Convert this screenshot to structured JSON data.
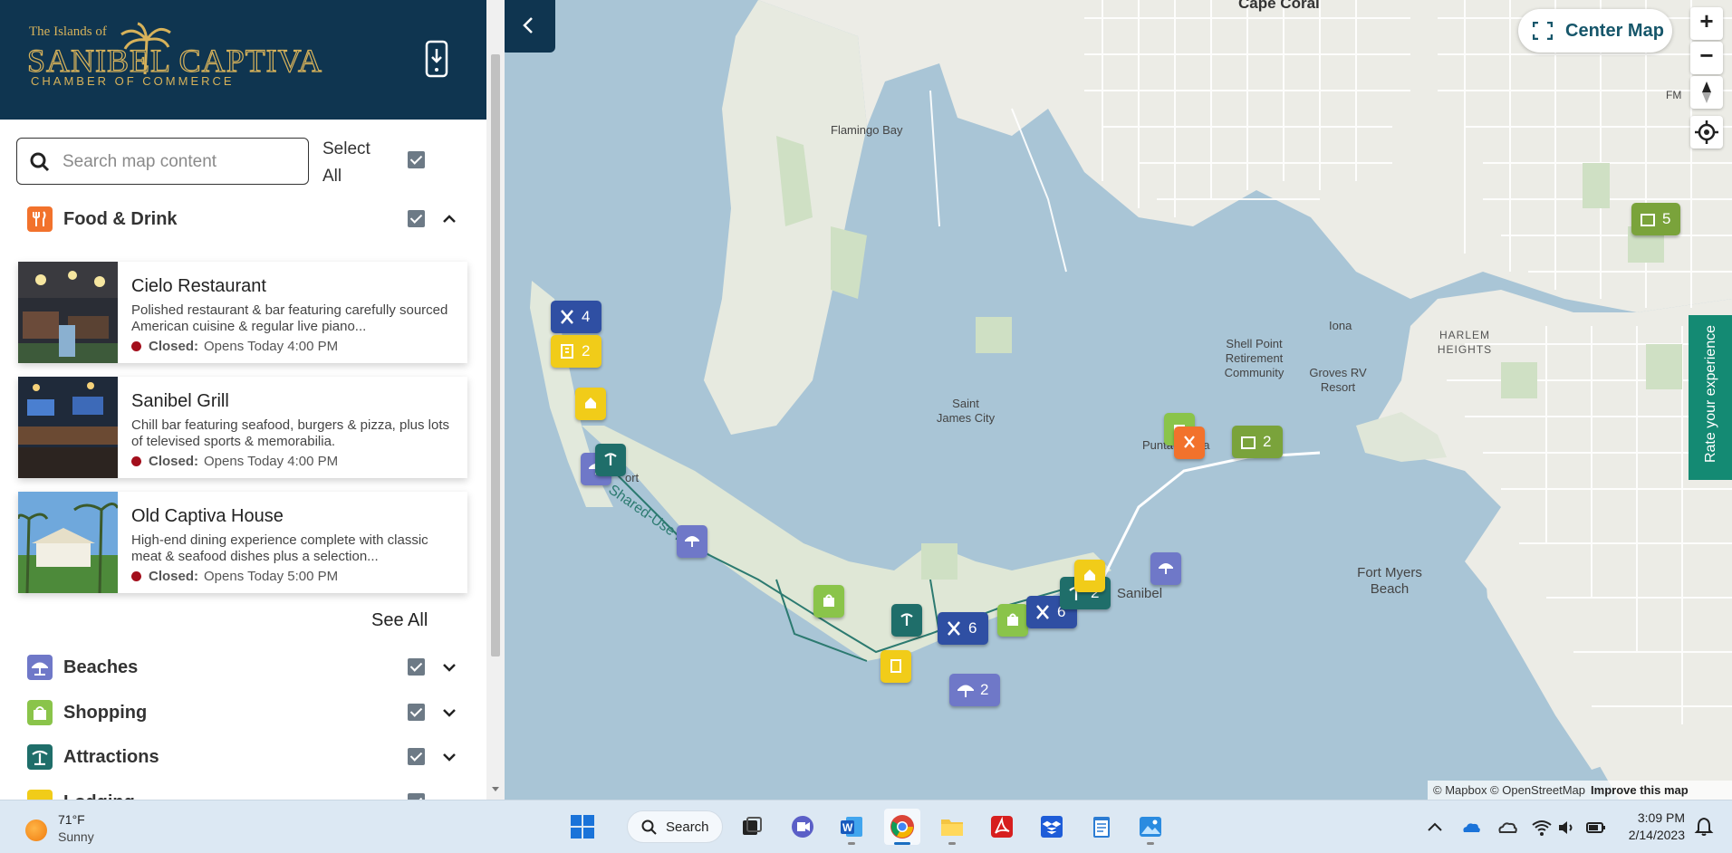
{
  "colors": {
    "header_bg": "#0f3550",
    "gold": "#d7b25a",
    "food": "#f2722c",
    "beaches": "#6f78c8",
    "shopping": "#8ac44a",
    "attractions": "#1f6e6a",
    "lodging": "#f1cc19",
    "rate_tab": "#148a73",
    "water": "#a9c5d6",
    "land": "#f1f1ec",
    "status_closed": "#a30f1c"
  },
  "logo": {
    "line1": "The Islands of",
    "line2": "SANIBEL CAPTIVA",
    "line3": "CHAMBER OF COMMERCE"
  },
  "search": {
    "placeholder": "Search map content",
    "value": ""
  },
  "select_all": {
    "label": "Select All",
    "checked": true
  },
  "categories": [
    {
      "label": "Food & Drink",
      "icon": "utensils-icon",
      "checked": true,
      "expanded": true
    },
    {
      "label": "Beaches",
      "icon": "beach-umbrella-icon",
      "checked": true,
      "expanded": false
    },
    {
      "label": "Shopping",
      "icon": "shopping-bag-icon",
      "checked": true,
      "expanded": false
    },
    {
      "label": "Attractions",
      "icon": "palm-tree-icon",
      "checked": true,
      "expanded": false
    },
    {
      "label": "Lodging",
      "icon": "hotel-icon",
      "checked": true,
      "expanded": false
    }
  ],
  "places": [
    {
      "title": "Cielo Restaurant",
      "desc": "Polished restaurant & bar featuring carefully sourced American cuisine & regular live piano...",
      "status": "Closed:",
      "hours": "Opens Today 4:00 PM"
    },
    {
      "title": "Sanibel Grill",
      "desc": "Chill bar featuring seafood, burgers & pizza, plus lots of televised sports & memorabilia.",
      "status": "Closed:",
      "hours": "Opens Today 4:00 PM"
    },
    {
      "title": "Old Captiva House",
      "desc": "High-end dining experience complete with classic meat & seafood dishes plus a selection...",
      "status": "Closed:",
      "hours": "Opens Today 5:00 PM"
    }
  ],
  "see_all": "See All",
  "map": {
    "center_map": "Center Map",
    "zoom_in": "+",
    "zoom_out": "−",
    "rate": "Rate your experience",
    "attribution": "© Mapbox © OpenStreetMap",
    "improve": "Improve this map",
    "labels": {
      "cape_coral": "Cape Coral",
      "flamingo_bay": "Flamingo Bay",
      "shell_point": "Shell Point Retirement Community",
      "iona": "Iona",
      "harlem": "HARLEM HEIGHTS",
      "groves": "Groves RV Resort",
      "st_james": "Saint James City",
      "punta_rassa": "Punta Rassa",
      "sanibel": "Sanibel",
      "fort_myers_beach": "Fort Myers Beach",
      "shared_use_path": "Shared-Use Path",
      "captiva_port": "ort",
      "fm": "FM"
    },
    "counts": {
      "food_4": "4",
      "lodging_2": "2",
      "food_6a": "6",
      "food_6b": "6",
      "beach_2": "2",
      "attr_2": "2",
      "hotel_2": "2",
      "hotel_5": "5"
    }
  },
  "taskbar": {
    "temp": "71°F",
    "weather": "Sunny",
    "search": "Search",
    "time": "3:09 PM",
    "date": "2/14/2023",
    "apps": [
      "windows-start-icon",
      "task-view-icon",
      "teams-icon",
      "word-icon",
      "chrome-icon",
      "file-explorer-icon",
      "acrobat-icon",
      "dropbox-icon",
      "notepad-icon",
      "photos-icon"
    ]
  }
}
